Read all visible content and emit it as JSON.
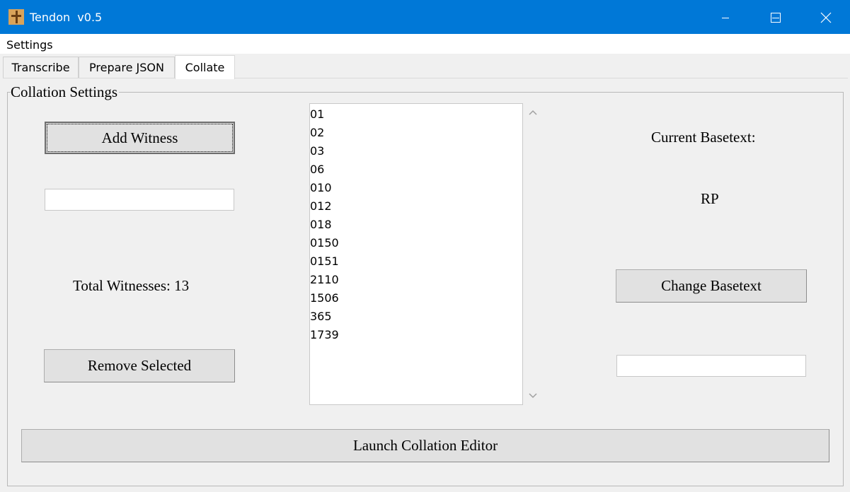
{
  "window": {
    "title": "Tendon  v0.5",
    "title_bar_color": "#0078d7",
    "controls": [
      "minimize-icon",
      "maximize-icon",
      "close-icon"
    ]
  },
  "menu": {
    "items": [
      {
        "label": "Settings"
      }
    ]
  },
  "tabs": [
    {
      "label": "Transcribe",
      "active": false
    },
    {
      "label": "Prepare JSON",
      "active": false
    },
    {
      "label": "Collate",
      "active": true
    }
  ],
  "collation": {
    "group_label": "Collation Settings",
    "add_witness_label": "Add Witness",
    "witness_input_value": "",
    "total_witnesses_label": "Total Witnesses: 13",
    "remove_selected_label": "Remove Selected",
    "witnesses": [
      "01",
      "02",
      "03",
      "06",
      "010",
      "012",
      "018",
      "0150",
      "0151",
      "2110",
      "1506",
      "365",
      "1739"
    ],
    "current_basetext_label": "Current Basetext:",
    "current_basetext_value": "RP",
    "change_basetext_label": "Change Basetext",
    "basetext_input_value": "",
    "launch_label": "Launch Collation Editor"
  }
}
